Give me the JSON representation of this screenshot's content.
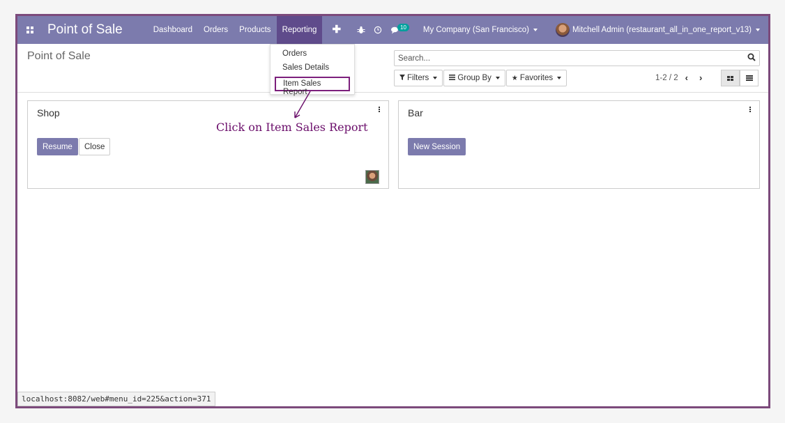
{
  "navbar": {
    "app_title": "Point of Sale",
    "menu": [
      "Dashboard",
      "Orders",
      "Products",
      "Reporting"
    ],
    "plus": "✚",
    "badge_count": "10",
    "company": "My Company (San Francisco)",
    "user": "Mitchell Admin (restaurant_all_in_one_report_v13)",
    "accent_color": "#7c7bad"
  },
  "control_panel": {
    "title": "Point of Sale",
    "search_placeholder": "Search...",
    "filters_label": "Filters",
    "group_by_label": "Group By",
    "favorites_label": "Favorites",
    "pager": "1-2 / 2"
  },
  "reporting_dropdown": {
    "items": [
      "Orders",
      "Sales Details",
      "Item Sales Report"
    ]
  },
  "cards": [
    {
      "name": "Shop",
      "primary_button": "Resume",
      "secondary_button": "Close"
    },
    {
      "name": "Bar",
      "primary_button": "New Session"
    }
  ],
  "annotation": "Click on Item Sales Report",
  "status_url": "localhost:8082/web#menu_id=225&action=371"
}
